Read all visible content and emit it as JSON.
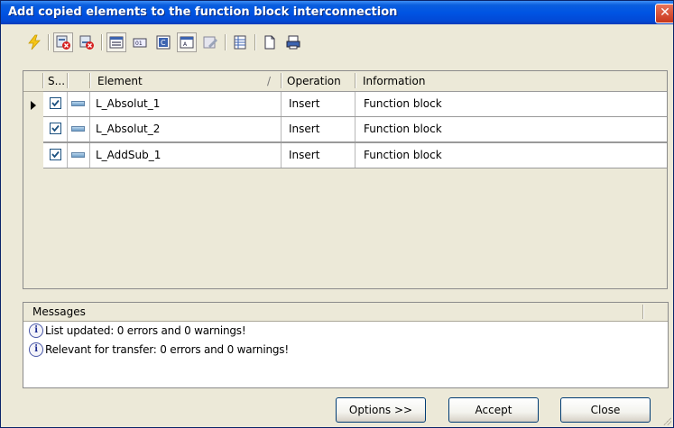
{
  "window": {
    "title": "Add copied elements to the function block interconnection",
    "close_glyph": "✕"
  },
  "toolbar": {
    "icons": [
      "lightning-icon",
      "delete-selected-icon",
      "delete-all-icon",
      "function-block-icon",
      "variable-icon",
      "constant-icon",
      "comment-icon",
      "edit-icon",
      "table-icon",
      "new-page-icon",
      "print-icon"
    ]
  },
  "grid": {
    "columns": {
      "status": "S...",
      "element": "Element",
      "sort_glyph": "/",
      "operation": "Operation",
      "information": "Information"
    },
    "rows": [
      {
        "checked": true,
        "element": "L_Absolut_1",
        "operation": "Insert",
        "information": "Function block",
        "current": true
      },
      {
        "checked": true,
        "element": "L_Absolut_2",
        "operation": "Insert",
        "information": "Function block",
        "current": false
      },
      {
        "checked": true,
        "element": "L_AddSub_1",
        "operation": "Insert",
        "information": "Function block",
        "current": false
      }
    ]
  },
  "messages": {
    "header": "Messages",
    "items": [
      {
        "icon": "info-icon",
        "glyph": "i",
        "text": "List updated: 0 errors and 0 warnings!"
      },
      {
        "icon": "info-icon",
        "glyph": "i",
        "text": "Relevant for transfer: 0 errors and 0 warnings!"
      }
    ]
  },
  "buttons": {
    "options": "Options >>",
    "accept": "Accept",
    "close": "Close"
  },
  "colors": {
    "titlebar": "#0054e3",
    "face": "#ece9d8",
    "check": "#1c5180"
  }
}
